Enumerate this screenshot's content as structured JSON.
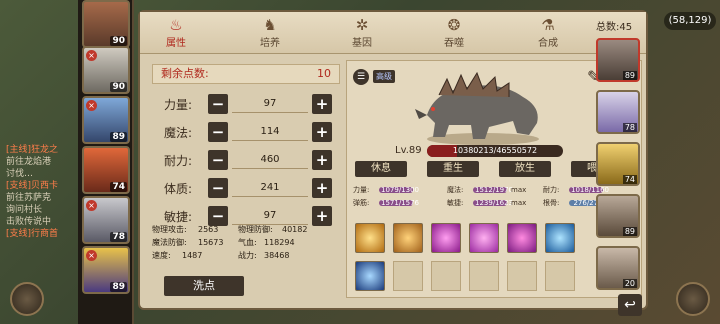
{
  "chat": {
    "lines": [
      "[主线]狂龙之",
      "前往龙焰港",
      "讨伐…",
      "[支线]贝西卡",
      "前往苏萨克",
      "询问村长",
      "击败传说中",
      "[支线]行商首"
    ]
  },
  "coords": "(58,129)",
  "hero_list": [
    {
      "level": "90"
    },
    {
      "level": "90"
    },
    {
      "level": "89"
    },
    {
      "level": "74"
    },
    {
      "level": "78"
    },
    {
      "level": "89"
    }
  ],
  "tabs": [
    {
      "label": "属性",
      "icon": "attribute-icon",
      "active": true
    },
    {
      "label": "培养",
      "icon": "train-icon",
      "active": false
    },
    {
      "label": "基因",
      "icon": "gene-icon",
      "active": false
    },
    {
      "label": "吞噬",
      "icon": "devour-icon",
      "active": false
    },
    {
      "label": "合成",
      "icon": "synthesis-icon",
      "active": false
    }
  ],
  "attributes": {
    "remaining_label": "剩余点数:",
    "remaining_value": "10",
    "rows": [
      {
        "label": "力量:",
        "value": "97"
      },
      {
        "label": "魔法:",
        "value": "114"
      },
      {
        "label": "耐力:",
        "value": "460"
      },
      {
        "label": "体质:",
        "value": "241"
      },
      {
        "label": "敏捷:",
        "value": "97"
      }
    ],
    "stats": [
      {
        "label": "物理攻击:",
        "value": "2563"
      },
      {
        "label": "物理防御:",
        "value": "40182"
      },
      {
        "label": "魔法防御:",
        "value": "15673"
      },
      {
        "label": "气血:",
        "value": "118294"
      },
      {
        "label": "速度:",
        "value": "1487"
      },
      {
        "label": "战力:",
        "value": "38468"
      }
    ],
    "wash_label": "洗点"
  },
  "pet": {
    "tag": "高级",
    "level": "Lv.89",
    "exp_text": "10380213/46550572",
    "exp_fraction": 0.223,
    "buttons": [
      "休息",
      "重生",
      "放生",
      "喂养"
    ],
    "growth": [
      {
        "label": "力量:",
        "value": "1079/1300"
      },
      {
        "label": "魔法:",
        "value": "1512/1970",
        "max": "max"
      },
      {
        "label": "耐力:",
        "value": "1018/1160"
      },
      {
        "label": "弹筋:",
        "value": "1571/1576"
      },
      {
        "label": "敏捷:",
        "value": "1239/1623",
        "max": "max"
      },
      {
        "label": "根骨:",
        "value": "276/276"
      }
    ],
    "skills": [
      "skill-fire-icon",
      "skill-claw-icon",
      "skill-arcane-icon",
      "skill-burst-icon",
      "skill-flame-icon",
      "skill-ice-icon",
      "skill-shield-icon"
    ]
  },
  "total": {
    "label": "总数:",
    "value": "45"
  },
  "side_pets": [
    {
      "level": "89"
    },
    {
      "level": "78"
    },
    {
      "level": "74"
    },
    {
      "level": "89"
    },
    {
      "level": "20"
    }
  ]
}
